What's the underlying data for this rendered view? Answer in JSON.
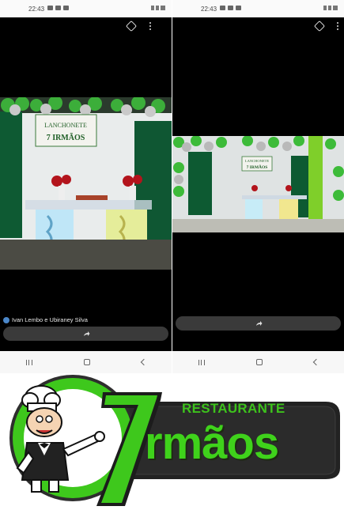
{
  "status_bar": {
    "time": "22:43"
  },
  "left_viewer": {
    "author": "Ivan Lembo e Ubiraney Silva",
    "photo_sign_line1": "LANCHONETE",
    "photo_sign_line2": "7 IRMÃOS"
  },
  "right_viewer": {
    "photo_sign_line1": "LANCHONETE",
    "photo_sign_line2": "7 IRMÃOS"
  },
  "logo": {
    "line1": "RESTAURANTE",
    "line2": "rmãos",
    "numeral": "7",
    "colors": {
      "green": "#3fd21b",
      "dark": "#1b1b1b"
    }
  },
  "icons": [
    "tag-icon",
    "more-options-icon",
    "share-icon",
    "recent-apps-icon",
    "home-icon",
    "back-icon",
    "avatar-icon"
  ]
}
